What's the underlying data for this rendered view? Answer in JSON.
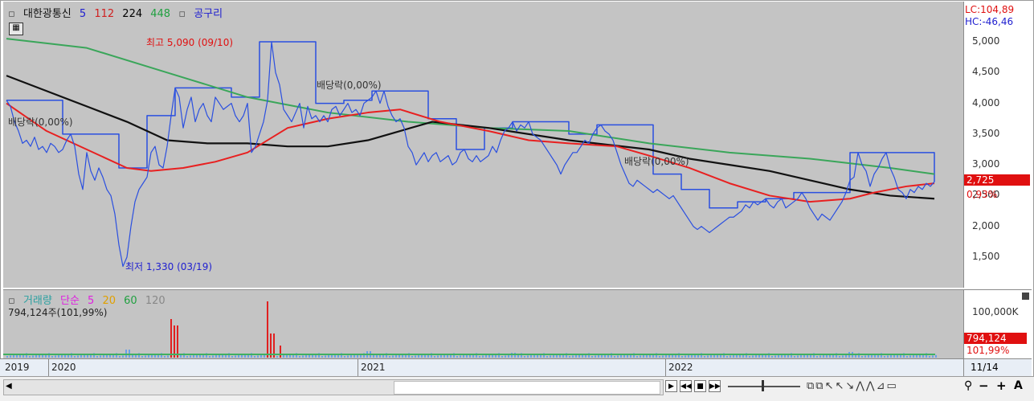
{
  "header": {
    "stock_name": "대한광통신",
    "ma_periods": [
      "5",
      "112",
      "224",
      "448"
    ],
    "ma_label_colors": [
      "#2020d0",
      "#d02020",
      "#000000",
      "#20a040"
    ],
    "indicator_name": "공구리"
  },
  "lc_hc": {
    "lc": "LC:104,89",
    "hc": "HC:-46,46"
  },
  "price_ticks": [
    "5,000",
    "4,500",
    "4,000",
    "3,500",
    "3,000",
    "2,500",
    "2,000",
    "1,500"
  ],
  "current_price": {
    "value": "2,725",
    "change": "0,93%"
  },
  "annotations": {
    "high": "최고 5,090 (09/10)",
    "low": "최저 1,330 (03/19)",
    "dividend_1": "배당락(0,00%)",
    "dividend_2": "배당락(0,00%)",
    "dividend_3": "배당락(0,00%)"
  },
  "volume_header": {
    "title": "거래량",
    "simple": "단순",
    "periods": [
      "5",
      "20",
      "60",
      "120"
    ],
    "period_colors": [
      "#e020e0",
      "#e0a000",
      "#20a040",
      "#888888"
    ],
    "value": "794,124주(101,99%)"
  },
  "volume_axis": {
    "tick": "100,000K",
    "current": "794,124",
    "ratio": "101,99%"
  },
  "x_labels": [
    "2019",
    "2020",
    "2021",
    "2022",
    "11/14"
  ],
  "chart_data": {
    "type": "line",
    "y_range": [
      1330,
      5200
    ],
    "price_series": [
      [
        0,
        4050
      ],
      [
        5,
        3950
      ],
      [
        10,
        3700
      ],
      [
        15,
        3550
      ],
      [
        20,
        3350
      ],
      [
        25,
        3400
      ],
      [
        30,
        3300
      ],
      [
        35,
        3450
      ],
      [
        40,
        3250
      ],
      [
        45,
        3300
      ],
      [
        50,
        3200
      ],
      [
        55,
        3350
      ],
      [
        60,
        3300
      ],
      [
        65,
        3200
      ],
      [
        70,
        3250
      ],
      [
        75,
        3400
      ],
      [
        80,
        3500
      ],
      [
        85,
        3300
      ],
      [
        90,
        2850
      ],
      [
        95,
        2600
      ],
      [
        100,
        3200
      ],
      [
        105,
        2900
      ],
      [
        110,
        2750
      ],
      [
        115,
        2950
      ],
      [
        120,
        2800
      ],
      [
        125,
        2600
      ],
      [
        130,
        2500
      ],
      [
        135,
        2200
      ],
      [
        140,
        1700
      ],
      [
        145,
        1350
      ],
      [
        150,
        1500
      ],
      [
        155,
        2000
      ],
      [
        160,
        2400
      ],
      [
        165,
        2600
      ],
      [
        170,
        2700
      ],
      [
        175,
        2800
      ],
      [
        180,
        3200
      ],
      [
        185,
        3300
      ],
      [
        190,
        3000
      ],
      [
        195,
        2950
      ],
      [
        200,
        3300
      ],
      [
        205,
        3800
      ],
      [
        210,
        4250
      ],
      [
        215,
        4100
      ],
      [
        220,
        3600
      ],
      [
        225,
        3900
      ],
      [
        230,
        4100
      ],
      [
        235,
        3700
      ],
      [
        240,
        3900
      ],
      [
        245,
        4000
      ],
      [
        250,
        3800
      ],
      [
        255,
        3700
      ],
      [
        260,
        4100
      ],
      [
        265,
        4000
      ],
      [
        270,
        3900
      ],
      [
        275,
        3950
      ],
      [
        280,
        4000
      ],
      [
        285,
        3800
      ],
      [
        290,
        3700
      ],
      [
        295,
        3800
      ],
      [
        300,
        4000
      ],
      [
        305,
        3200
      ],
      [
        310,
        3300
      ],
      [
        315,
        3500
      ],
      [
        320,
        3700
      ],
      [
        325,
        4050
      ],
      [
        330,
        5000
      ],
      [
        335,
        4500
      ],
      [
        340,
        4300
      ],
      [
        345,
        3900
      ],
      [
        350,
        3800
      ],
      [
        355,
        3700
      ],
      [
        360,
        3850
      ],
      [
        365,
        4000
      ],
      [
        370,
        3600
      ],
      [
        375,
        3950
      ],
      [
        380,
        3750
      ],
      [
        385,
        3800
      ],
      [
        390,
        3700
      ],
      [
        395,
        3800
      ],
      [
        400,
        3700
      ],
      [
        405,
        3900
      ],
      [
        410,
        3950
      ],
      [
        415,
        3800
      ],
      [
        420,
        3900
      ],
      [
        425,
        4000
      ],
      [
        430,
        3850
      ],
      [
        435,
        3900
      ],
      [
        440,
        3800
      ],
      [
        445,
        4000
      ],
      [
        450,
        4050
      ],
      [
        455,
        4100
      ],
      [
        460,
        4200
      ],
      [
        465,
        4000
      ],
      [
        470,
        4200
      ],
      [
        475,
        3950
      ],
      [
        480,
        3800
      ],
      [
        485,
        3700
      ],
      [
        490,
        3750
      ],
      [
        495,
        3600
      ],
      [
        500,
        3300
      ],
      [
        505,
        3200
      ],
      [
        510,
        3000
      ],
      [
        515,
        3100
      ],
      [
        520,
        3200
      ],
      [
        525,
        3050
      ],
      [
        530,
        3150
      ],
      [
        535,
        3200
      ],
      [
        540,
        3050
      ],
      [
        545,
        3100
      ],
      [
        550,
        3150
      ],
      [
        555,
        3000
      ],
      [
        560,
        3050
      ],
      [
        565,
        3200
      ],
      [
        570,
        3250
      ],
      [
        575,
        3100
      ],
      [
        580,
        3050
      ],
      [
        585,
        3150
      ],
      [
        590,
        3050
      ],
      [
        595,
        3100
      ],
      [
        600,
        3150
      ],
      [
        605,
        3300
      ],
      [
        610,
        3200
      ],
      [
        615,
        3400
      ],
      [
        620,
        3550
      ],
      [
        625,
        3600
      ],
      [
        630,
        3700
      ],
      [
        635,
        3550
      ],
      [
        640,
        3650
      ],
      [
        645,
        3600
      ],
      [
        650,
        3700
      ],
      [
        655,
        3500
      ],
      [
        660,
        3450
      ],
      [
        665,
        3400
      ],
      [
        670,
        3300
      ],
      [
        675,
        3200
      ],
      [
        680,
        3100
      ],
      [
        685,
        3000
      ],
      [
        690,
        2850
      ],
      [
        695,
        3000
      ],
      [
        700,
        3100
      ],
      [
        705,
        3200
      ],
      [
        710,
        3200
      ],
      [
        715,
        3300
      ],
      [
        720,
        3400
      ],
      [
        725,
        3350
      ],
      [
        730,
        3500
      ],
      [
        735,
        3600
      ],
      [
        740,
        3650
      ],
      [
        745,
        3550
      ],
      [
        750,
        3500
      ],
      [
        755,
        3400
      ],
      [
        760,
        3200
      ],
      [
        765,
        3000
      ],
      [
        770,
        2850
      ],
      [
        775,
        2700
      ],
      [
        780,
        2650
      ],
      [
        785,
        2750
      ],
      [
        790,
        2700
      ],
      [
        795,
        2650
      ],
      [
        800,
        2600
      ],
      [
        805,
        2550
      ],
      [
        810,
        2600
      ],
      [
        815,
        2550
      ],
      [
        820,
        2500
      ],
      [
        825,
        2450
      ],
      [
        830,
        2500
      ],
      [
        835,
        2400
      ],
      [
        840,
        2300
      ],
      [
        845,
        2200
      ],
      [
        850,
        2100
      ],
      [
        855,
        2000
      ],
      [
        860,
        1950
      ],
      [
        865,
        2000
      ],
      [
        870,
        1950
      ],
      [
        875,
        1900
      ],
      [
        880,
        1950
      ],
      [
        885,
        2000
      ],
      [
        890,
        2050
      ],
      [
        895,
        2100
      ],
      [
        900,
        2150
      ],
      [
        905,
        2150
      ],
      [
        910,
        2200
      ],
      [
        915,
        2250
      ],
      [
        920,
        2350
      ],
      [
        925,
        2300
      ],
      [
        930,
        2400
      ],
      [
        935,
        2350
      ],
      [
        940,
        2400
      ],
      [
        945,
        2450
      ],
      [
        950,
        2350
      ],
      [
        955,
        2300
      ],
      [
        960,
        2400
      ],
      [
        965,
        2450
      ],
      [
        970,
        2300
      ],
      [
        975,
        2350
      ],
      [
        980,
        2400
      ],
      [
        985,
        2450
      ],
      [
        990,
        2550
      ],
      [
        995,
        2450
      ],
      [
        1000,
        2300
      ],
      [
        1005,
        2200
      ],
      [
        1010,
        2100
      ],
      [
        1015,
        2200
      ],
      [
        1020,
        2150
      ],
      [
        1025,
        2100
      ],
      [
        1030,
        2200
      ],
      [
        1035,
        2300
      ],
      [
        1040,
        2400
      ],
      [
        1045,
        2550
      ],
      [
        1050,
        2750
      ],
      [
        1055,
        2800
      ],
      [
        1060,
        3200
      ],
      [
        1065,
        3000
      ],
      [
        1070,
        2900
      ],
      [
        1075,
        2650
      ],
      [
        1080,
        2850
      ],
      [
        1085,
        2950
      ],
      [
        1090,
        3100
      ],
      [
        1095,
        3200
      ],
      [
        1100,
        2950
      ],
      [
        1105,
        2800
      ],
      [
        1110,
        2600
      ],
      [
        1115,
        2550
      ],
      [
        1120,
        2450
      ],
      [
        1125,
        2600
      ],
      [
        1130,
        2550
      ],
      [
        1135,
        2650
      ],
      [
        1140,
        2600
      ],
      [
        1145,
        2700
      ],
      [
        1150,
        2650
      ],
      [
        1155,
        2725
      ]
    ],
    "ma112": [
      [
        0,
        4000
      ],
      [
        50,
        3550
      ],
      [
        100,
        3250
      ],
      [
        150,
        2950
      ],
      [
        180,
        2900
      ],
      [
        220,
        2950
      ],
      [
        260,
        3050
      ],
      [
        300,
        3200
      ],
      [
        350,
        3600
      ],
      [
        400,
        3750
      ],
      [
        450,
        3850
      ],
      [
        490,
        3900
      ],
      [
        540,
        3700
      ],
      [
        600,
        3550
      ],
      [
        650,
        3400
      ],
      [
        700,
        3350
      ],
      [
        760,
        3300
      ],
      [
        800,
        3150
      ],
      [
        850,
        2950
      ],
      [
        900,
        2700
      ],
      [
        950,
        2500
      ],
      [
        1000,
        2400
      ],
      [
        1050,
        2450
      ],
      [
        1080,
        2550
      ],
      [
        1120,
        2650
      ],
      [
        1155,
        2700
      ]
    ],
    "ma224": [
      [
        0,
        4450
      ],
      [
        50,
        4200
      ],
      [
        100,
        3950
      ],
      [
        150,
        3700
      ],
      [
        200,
        3400
      ],
      [
        250,
        3350
      ],
      [
        300,
        3350
      ],
      [
        350,
        3300
      ],
      [
        400,
        3300
      ],
      [
        450,
        3400
      ],
      [
        490,
        3550
      ],
      [
        530,
        3700
      ],
      [
        600,
        3600
      ],
      [
        700,
        3400
      ],
      [
        800,
        3250
      ],
      [
        850,
        3100
      ],
      [
        900,
        3000
      ],
      [
        950,
        2900
      ],
      [
        1000,
        2750
      ],
      [
        1050,
        2600
      ],
      [
        1100,
        2500
      ],
      [
        1155,
        2450
      ]
    ],
    "ma448": [
      [
        0,
        5050
      ],
      [
        100,
        4900
      ],
      [
        200,
        4500
      ],
      [
        300,
        4100
      ],
      [
        400,
        3850
      ],
      [
        500,
        3700
      ],
      [
        600,
        3600
      ],
      [
        700,
        3550
      ],
      [
        800,
        3350
      ],
      [
        900,
        3200
      ],
      [
        1000,
        3100
      ],
      [
        1100,
        2950
      ],
      [
        1155,
        2850
      ]
    ]
  },
  "colors": {
    "price": "#2a4fe0",
    "ma112": "#e82020",
    "ma224": "#111111",
    "ma448": "#3aa65a",
    "pane": "#c4c4c4"
  }
}
